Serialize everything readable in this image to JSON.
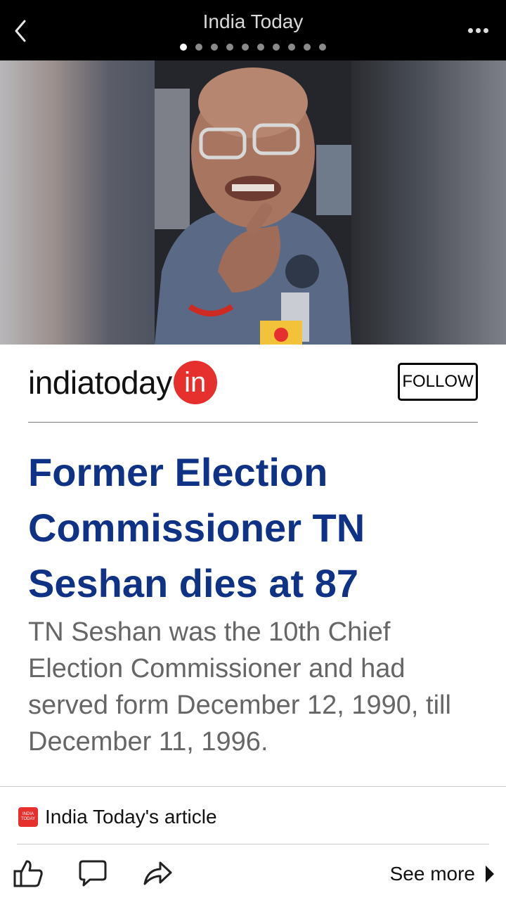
{
  "header": {
    "title": "India Today",
    "page_indicator": {
      "total": 10,
      "active": 1
    }
  },
  "brand": {
    "name": "indiatoday",
    "badge": "in"
  },
  "follow_label": "FOLLOW",
  "article": {
    "headline": "Former Election Commissioner TN Seshan dies at 87",
    "summary": "TN Seshan was the 10th Chief Election Commissioner and had served form December 12, 1990, till December 11, 1996."
  },
  "source": {
    "label": "India Today's article",
    "logo_text": "INDIA TODAY"
  },
  "actions": {
    "see_more": "See more"
  },
  "icons": {
    "back": "chevron-left-icon",
    "more": "more-horizontal-icon",
    "like": "thumbs-up-icon",
    "comment": "comment-icon",
    "share": "share-icon",
    "see_more_arrow": "play-right-icon"
  },
  "colors": {
    "topbar": "#000000",
    "headline": "#0f3286",
    "brand_accent": "#e5302e",
    "summary": "#666666"
  }
}
